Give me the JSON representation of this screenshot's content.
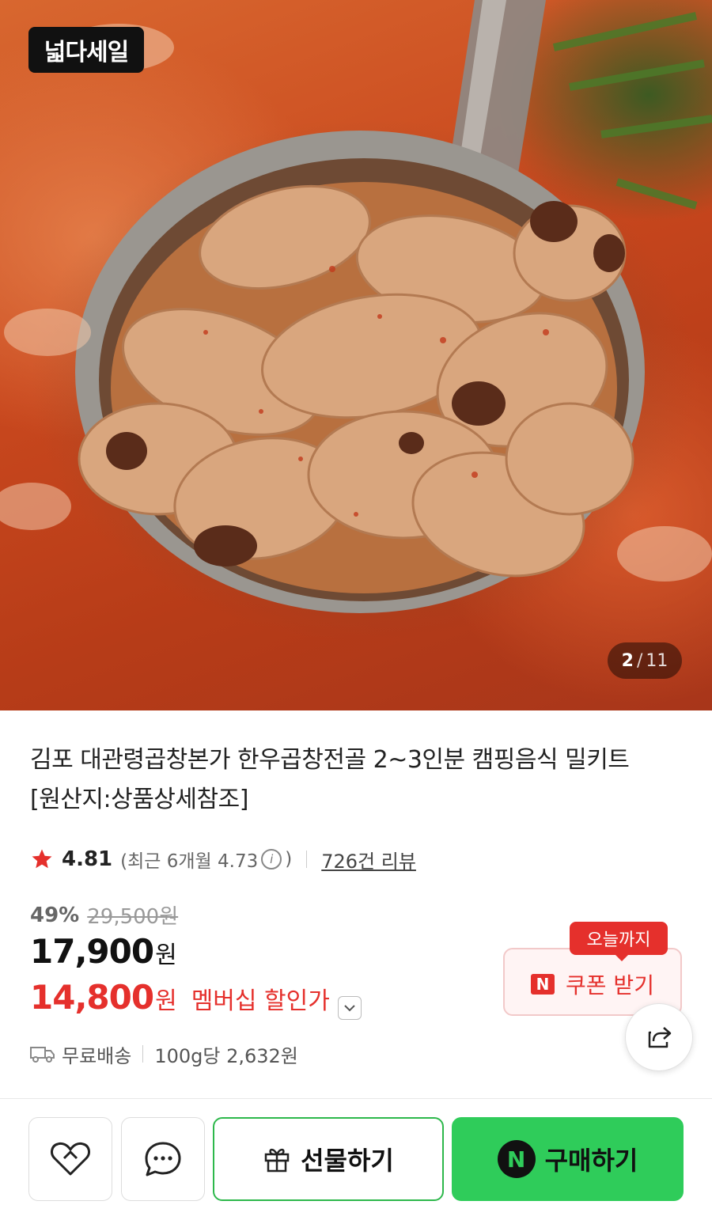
{
  "hero": {
    "badge": "넓다세일",
    "counter_current": "2",
    "counter_separator": "/",
    "counter_total": "11"
  },
  "product": {
    "title": "김포 대관령곱창본가 한우곱창전골 2~3인분 캠핑음식 밀키트 [원산지:상품상세참조]",
    "rating": "4.81",
    "recent_prefix": "(최근 6개월 4.73",
    "recent_suffix": ")",
    "info_glyph": "i",
    "review_count": "726건 리뷰",
    "discount_rate": "49%",
    "original_price": "29,500원",
    "price": "17,900",
    "price_unit": "원",
    "member_price": "14,800",
    "member_unit": "원",
    "member_label": "멤버십 할인가",
    "shipping": "무료배송",
    "unit_price": "100g당 2,632원"
  },
  "coupon": {
    "deadline": "오늘까지",
    "label": "쿠폰 받기",
    "pay_icon": "N"
  },
  "actions": {
    "gift_label": "선물하기",
    "buy_label": "구매하기",
    "buy_icon": "N"
  },
  "colors": {
    "accent_red": "#e5302c",
    "naver_green": "#2fcc5a",
    "gift_border": "#2db84b"
  },
  "icons": [
    "star-icon",
    "info-icon",
    "chevron-down-icon",
    "truck-icon",
    "share-icon",
    "heart-icon",
    "chat-icon",
    "gift-icon",
    "naver-n-icon"
  ]
}
